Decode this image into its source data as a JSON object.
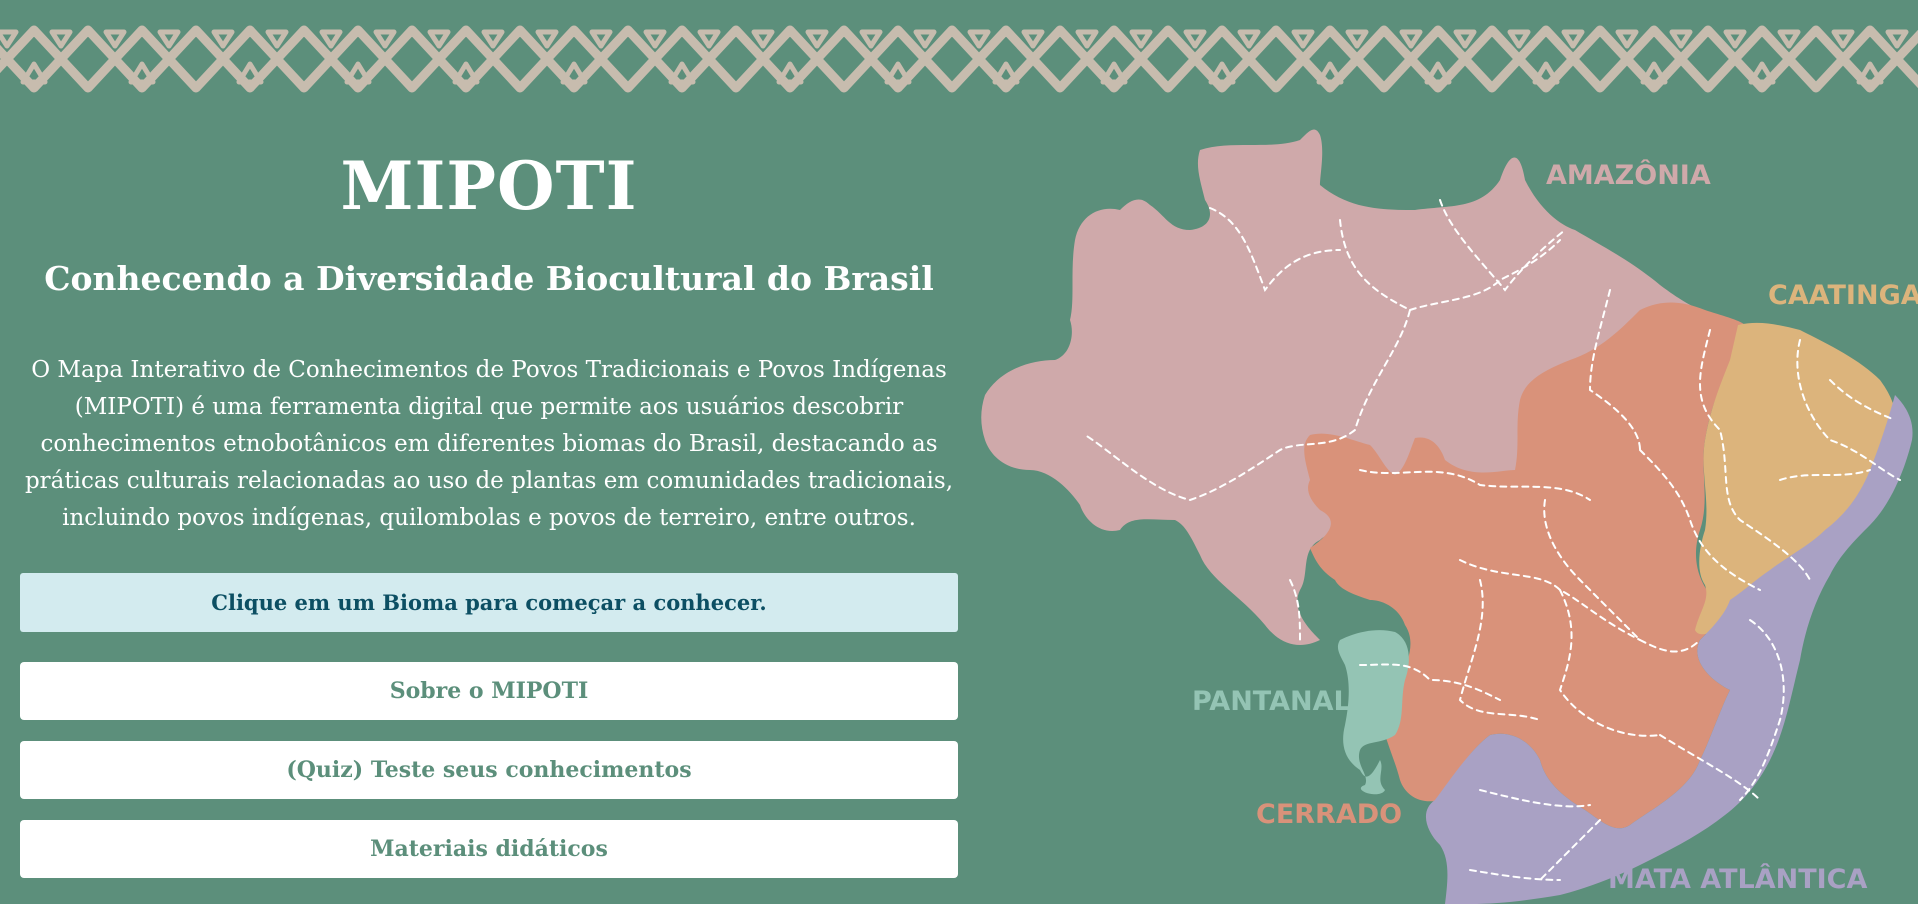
{
  "app": {
    "title": "MIPOTI",
    "subtitle": "Conhecendo a Diversidade Biocultural do Brasil",
    "description": "O Mapa Interativo de Conhecimentos de Povos Tradicionais e Povos Indígenas (MIPOTI) é uma ferramenta digital que permite aos usuários descobrir conhecimentos etnobotânicos em diferentes biomas do Brasil, destacando as práticas culturais relacionadas ao uso de plantas em comunidades tradicionais, incluindo povos indígenas, quilombolas e povos de terreiro, entre outros."
  },
  "hint": {
    "text": "Clique em um Bioma para começar a conhecer."
  },
  "buttons": {
    "about": "Sobre o MIPOTI",
    "quiz": "(Quiz) Teste seus conhecimentos",
    "materials": "Materiais didáticos"
  },
  "map": {
    "biomes": [
      {
        "id": "amazonia",
        "label": "AMAZÔNIA",
        "color": "#cfa9aa"
      },
      {
        "id": "caatinga",
        "label": "CAATINGA",
        "color": "#dcb47c"
      },
      {
        "id": "pantanal",
        "label": "PANTANAL",
        "color": "#94c4b4"
      },
      {
        "id": "cerrado",
        "label": "CERRADO",
        "color": "#d9927a"
      },
      {
        "id": "mata_atlantica",
        "label": "MATA ATLÂNTICA",
        "color": "#a9a1c4"
      }
    ]
  },
  "colors": {
    "background": "#5c8f7b",
    "banner_pattern": "#c7bcae",
    "hint_background": "#d3ebef",
    "hint_text": "#0c4f63",
    "button_text": "#5c8f7b"
  }
}
